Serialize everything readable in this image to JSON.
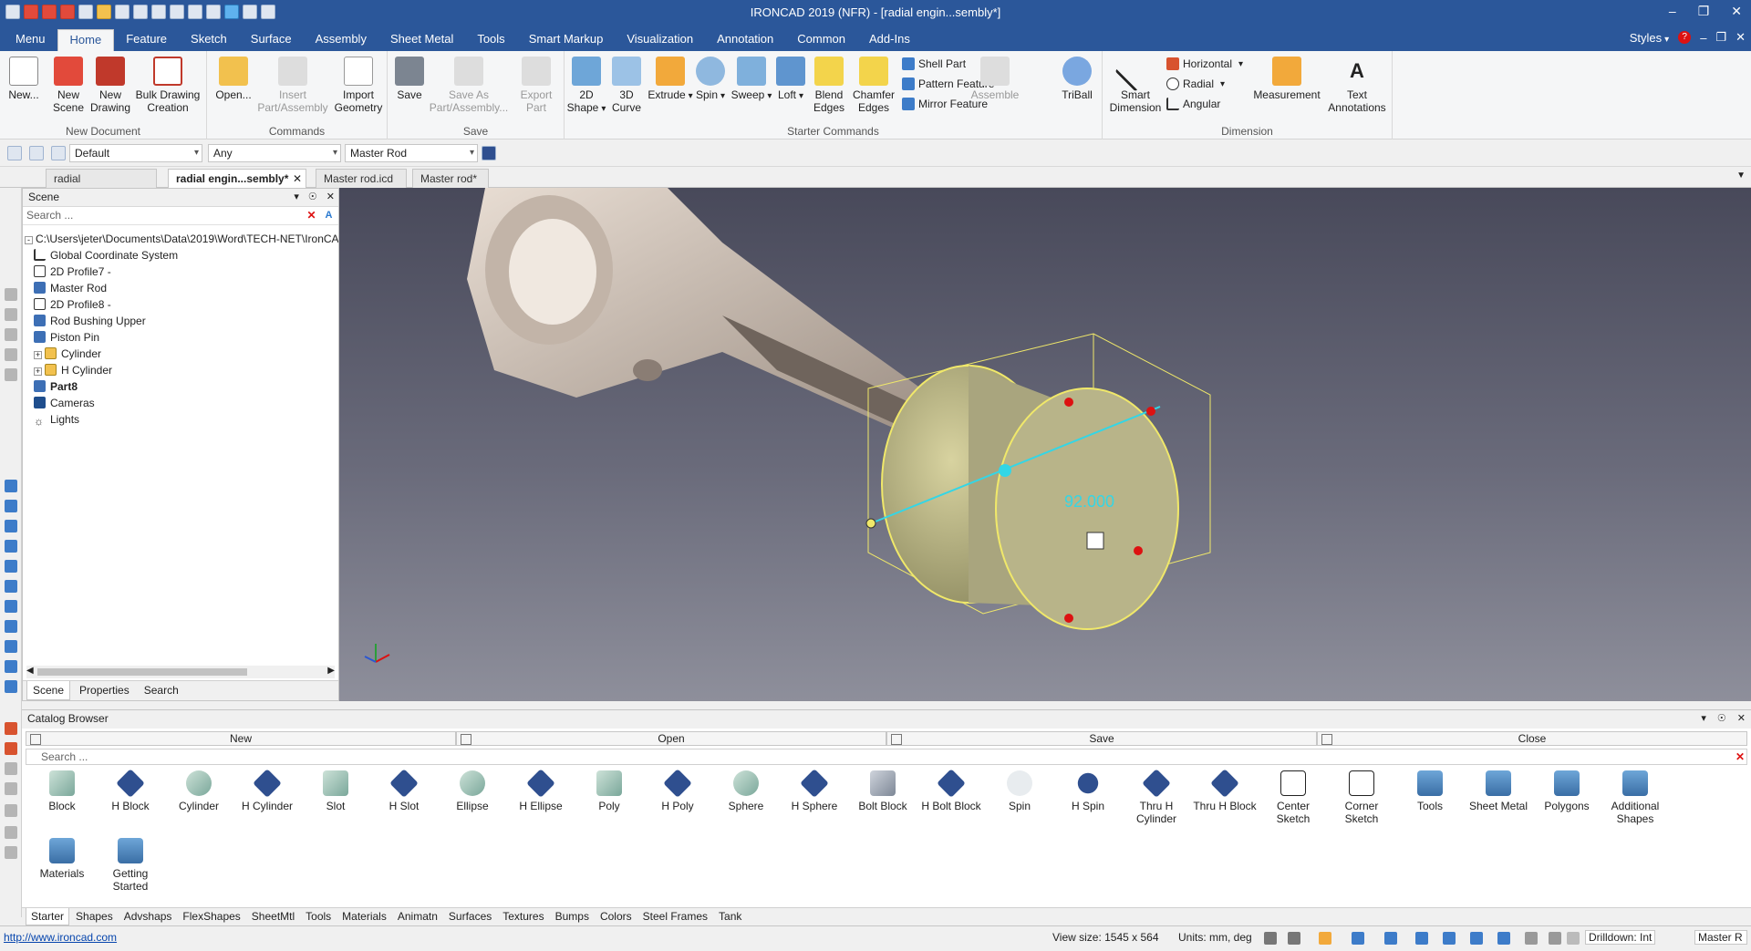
{
  "window": {
    "title": "IRONCAD 2019 (NFR) - [radial engin...sembly*]",
    "controls": [
      "–",
      "❐",
      "✕"
    ]
  },
  "menubar": {
    "tabs": [
      "Menu",
      "Home",
      "Feature",
      "Sketch",
      "Surface",
      "Assembly",
      "Sheet Metal",
      "Tools",
      "Smart Markup",
      "Visualization",
      "Annotation",
      "Common",
      "Add-Ins"
    ],
    "active": "Home",
    "styles_label": "Styles"
  },
  "ribbon": {
    "groups": {
      "new_document": "New Document",
      "commands": "Commands",
      "save": "Save",
      "starter_commands": "Starter Commands",
      "dimension": "Dimension"
    },
    "buttons": {
      "new": "New...",
      "new_scene": "New Scene",
      "new_drawing": "New Drawing",
      "bulk_drawing_creation": "Bulk Drawing Creation",
      "open": "Open...",
      "insert_part_assembly": "Insert Part/Assembly",
      "import_geometry": "Import Geometry",
      "save": "Save",
      "save_as_part_assembly": "Save As Part/Assembly...",
      "export_part": "Export Part",
      "shape_2d": "2D Shape",
      "curve_3d": "3D Curve",
      "extrude": "Extrude",
      "spin": "Spin",
      "sweep": "Sweep",
      "loft": "Loft",
      "blend_edges": "Blend Edges",
      "chamfer_edges": "Chamfer Edges",
      "shell_part": "Shell Part",
      "pattern_feature": "Pattern Feature",
      "mirror_feature": "Mirror Feature",
      "assemble": "Assemble",
      "triball": "TriBall",
      "smart_dimension": "Smart Dimension",
      "horizontal": "Horizontal",
      "radial": "Radial",
      "angular": "Angular",
      "measurement": "Measurement",
      "text_annotations": "Text Annotations"
    }
  },
  "toolbar": {
    "combo_style": "Default",
    "combo_filter": "Any",
    "combo_part": "Master Rod"
  },
  "doc_tabs": [
    "radial engin...bly.icd",
    "radial engin...sembly*",
    "Master rod.icd",
    "Master rod*"
  ],
  "scene": {
    "title": "Scene",
    "search_placeholder": "Search ...",
    "tree": [
      {
        "label": "C:\\Users\\jeter\\Documents\\Data\\2019\\Word\\TECH-NET\\IronCA",
        "icon": "file-icon"
      },
      {
        "label": "Global Coordinate System",
        "icon": "axis-icon"
      },
      {
        "label": "2D Profile7 -",
        "icon": "profile-icon"
      },
      {
        "label": "Master Rod",
        "icon": "part-icon"
      },
      {
        "label": "2D Profile8 -",
        "icon": "profile-icon"
      },
      {
        "label": "Rod Bushing Upper",
        "icon": "part-icon"
      },
      {
        "label": "Piston Pin",
        "icon": "part-icon"
      },
      {
        "label": "Cylinder",
        "icon": "cylinder-icon"
      },
      {
        "label": "H Cylinder",
        "icon": "cylinder-icon"
      },
      {
        "label": "Part8",
        "icon": "part-icon"
      },
      {
        "label": "Cameras",
        "icon": "camera-icon"
      },
      {
        "label": "Lights",
        "icon": "light-icon"
      }
    ],
    "bottom_tabs": [
      "Scene",
      "Properties",
      "Search"
    ]
  },
  "viewport": {
    "dimension_value": "92.000"
  },
  "catalog": {
    "title": "Catalog Browser",
    "actions": [
      "New",
      "Open",
      "Save",
      "Close"
    ],
    "search_placeholder": "Search ...",
    "items": [
      "Block",
      "H Block",
      "Cylinder",
      "H Cylinder",
      "Slot",
      "H Slot",
      "Ellipse",
      "H Ellipse",
      "Poly",
      "H Poly",
      "Sphere",
      "H Sphere",
      "Bolt Block",
      "H Bolt Block",
      "Spin",
      "H Spin",
      "Thru H Cylinder",
      "Thru H Block",
      "Center Sketch",
      "Corner Sketch",
      "Tools",
      "Sheet Metal",
      "Polygons",
      "Additional Shapes",
      "Materials",
      "Getting Started"
    ],
    "tabs": [
      "Starter",
      "Shapes",
      "Advshaps",
      "FlexShapes",
      "SheetMtl",
      "Tools",
      "Materials",
      "Animatn",
      "Surfaces",
      "Textures",
      "Bumps",
      "Colors",
      "Steel Frames",
      "Tank"
    ]
  },
  "status": {
    "link": "http://www.ironcad.com",
    "view_size": "View size: 1545 x  564",
    "units": "Units: mm, deg",
    "drilldown": "Drilldown: Int",
    "part": "Master R"
  }
}
